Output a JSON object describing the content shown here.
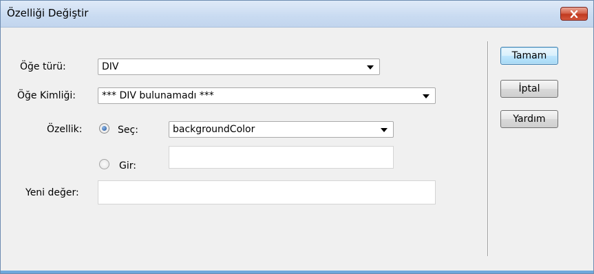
{
  "window": {
    "title": "Özelliği Değiştir"
  },
  "form": {
    "element_type": {
      "label": "Öğe türü:",
      "value": "DIV"
    },
    "element_id": {
      "label": "Öğe Kimliği:",
      "value": "*** DIV bulunamadı ***"
    },
    "property": {
      "label": "Özellik:",
      "select_option": {
        "label": "Seç:",
        "checked": true,
        "value": "backgroundColor"
      },
      "enter_option": {
        "label": "Gir:",
        "checked": false,
        "value": ""
      }
    },
    "new_value": {
      "label": "Yeni değer:",
      "value": ""
    }
  },
  "buttons": {
    "ok": "Tamam",
    "cancel": "İptal",
    "help": "Yardım"
  },
  "colors": {
    "close_button": "#c0391f",
    "default_button_border": "#3c7fb1",
    "bottom_accent": "#6fa8dc"
  },
  "icons": {
    "close": "close-x-icon",
    "dropdown": "chevron-down-icon",
    "radio": "radio-button-icon"
  }
}
